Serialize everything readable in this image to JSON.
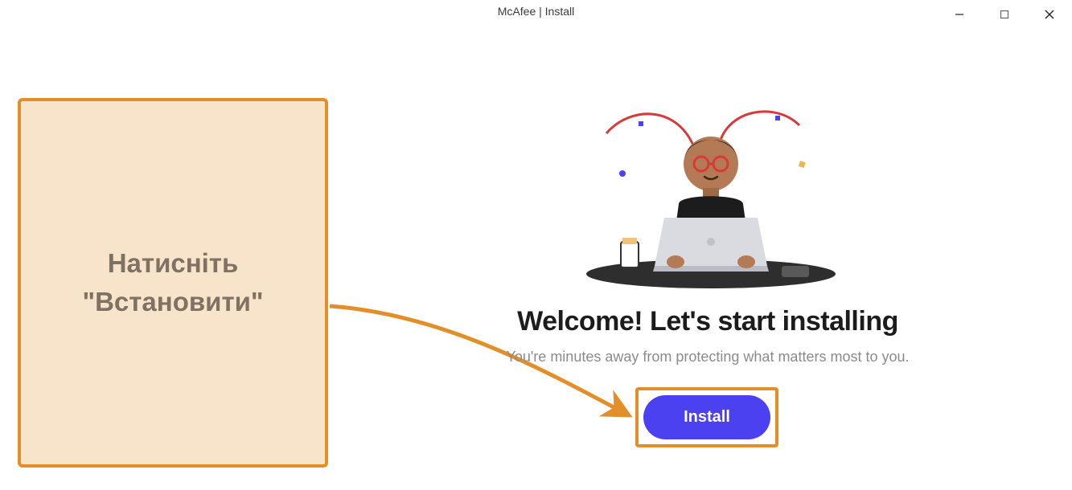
{
  "window": {
    "title": "McAfee | Install"
  },
  "annotation": {
    "callout_text": "Натисніть \"Встановити\""
  },
  "main": {
    "heading": "Welcome! Let's start installing",
    "subheading": "You're minutes away from protecting what matters most to you.",
    "install_label": "Install"
  },
  "colors": {
    "accent_orange": "#e28f2a",
    "callout_bg": "#f8e4cb",
    "button_blue": "#4b41f0"
  }
}
